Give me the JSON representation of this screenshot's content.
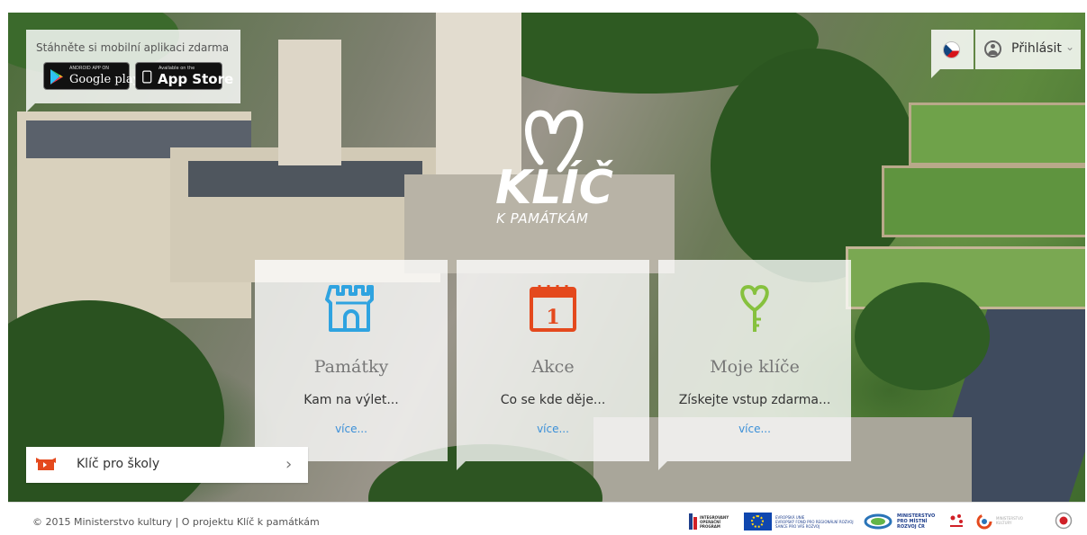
{
  "app_promo": {
    "text": "Stáhněte si mobilní aplikaci zdarma",
    "google": {
      "small": "ANDROID APP ON",
      "big": "Google play"
    },
    "apple": {
      "small": "Available on the",
      "big": "App Store"
    }
  },
  "header": {
    "login_label": "Přihlásit",
    "chevron": "⌄"
  },
  "logo": {
    "main": "KLÍČ",
    "sub": "K PAMÁTKÁM"
  },
  "cards": [
    {
      "title": "Památky",
      "desc": "Kam na výlet...",
      "more": "více..."
    },
    {
      "title": "Akce",
      "desc": "Co se kde děje...",
      "more": "více...",
      "calendar_day": "1"
    },
    {
      "title": "Moje klíče",
      "desc": "Získejte vstup zdarma...",
      "more": "více..."
    }
  ],
  "schools": {
    "label": "Klíč pro školy",
    "chevron": "›"
  },
  "footer": {
    "copyright": "© 2015 Ministerstvo kultury",
    "separator": "|",
    "about_link": "O projektu Klíč k památkám",
    "partners": {
      "iop": [
        "INTEGROVANÝ",
        "OPERAČNÍ",
        "PROGRAM"
      ],
      "eu": [
        "EVROPSKÁ UNIE",
        "EVROPSKÝ FOND PRO REGIONÁLNÍ ROZVOJ",
        "ŠANCE PRO VÁŠ ROZVOJ"
      ],
      "mmr": [
        "MINISTERSTVO",
        "PRO MÍSTNÍ",
        "ROZVOJ ČR"
      ],
      "mk": [
        "MINISTERSTVO",
        "KULTURY"
      ]
    }
  },
  "colors": {
    "card_icon_blue": "#2fa3e0",
    "card_icon_red": "#e4491d",
    "card_icon_green": "#86c13e",
    "link_blue": "#3a8fd8"
  }
}
